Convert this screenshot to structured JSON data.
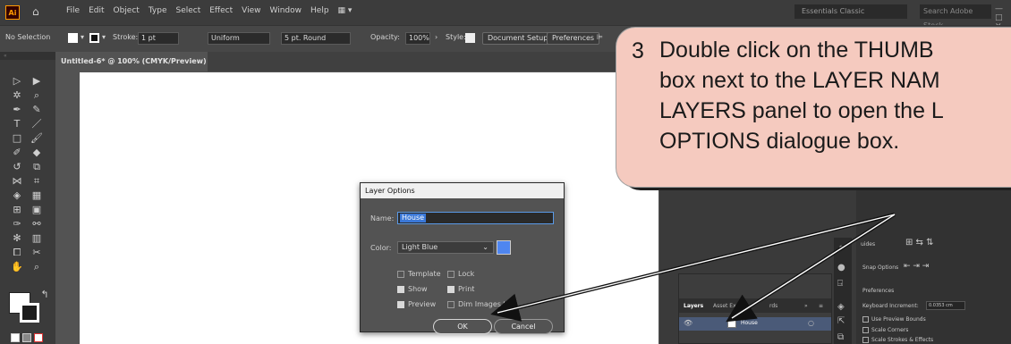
{
  "app": {
    "logo": "Ai",
    "window_controls": "— □ ✕"
  },
  "menu": [
    "File",
    "Edit",
    "Object",
    "Type",
    "Select",
    "Effect",
    "View",
    "Window",
    "Help"
  ],
  "menu_extra": "▦ ▾",
  "workspace": "Essentials Classic",
  "search_placeholder": "Search Adobe Stock",
  "control_bar": {
    "selection": "No Selection",
    "stroke_label": "Stroke:",
    "stroke_value": "1 pt",
    "profile": "Uniform",
    "brush": "5 pt. Round",
    "opacity_label": "Opacity:",
    "opacity_value": "100%",
    "style_label": "Style:",
    "doc_setup": "Document Setup",
    "preferences": "Preferences"
  },
  "document_tab": {
    "title": "Untitled-6* @ 100% (CMYK/Preview)",
    "close": "×"
  },
  "dialog": {
    "title": "Layer Options",
    "name_label": "Name:",
    "name_value": "House",
    "color_label": "Color:",
    "color_value": "Light Blue",
    "color_hex": "#4f86f0",
    "options": [
      {
        "label": "Template",
        "checked": false
      },
      {
        "label": "Lock",
        "checked": false
      },
      {
        "label": "Show",
        "checked": true
      },
      {
        "label": "Print",
        "checked": true
      },
      {
        "label": "Preview",
        "checked": true
      },
      {
        "label": "Dim Images to:",
        "checked": false
      }
    ],
    "ok": "OK",
    "cancel": "Cancel"
  },
  "layers_panel": {
    "tabs": [
      "Layers",
      "Asset Exp",
      "rds",
      "»",
      "≡"
    ],
    "layer_name": "House"
  },
  "properties": {
    "snap_options": "Snap Options",
    "preferences": "Preferences",
    "keyboard_increment_label": "Keyboard Increment:",
    "keyboard_increment_value": "0.0353 cm",
    "checkboxes": [
      "Use Preview Bounds",
      "Scale Corners",
      "Scale Strokes & Effects"
    ],
    "guides": "uides"
  },
  "callout": {
    "number": "3",
    "lines": [
      "Double click on the THUMB",
      "box next to the LAYER NAM",
      "LAYERS panel to open the L",
      "OPTIONS dialogue box."
    ]
  }
}
